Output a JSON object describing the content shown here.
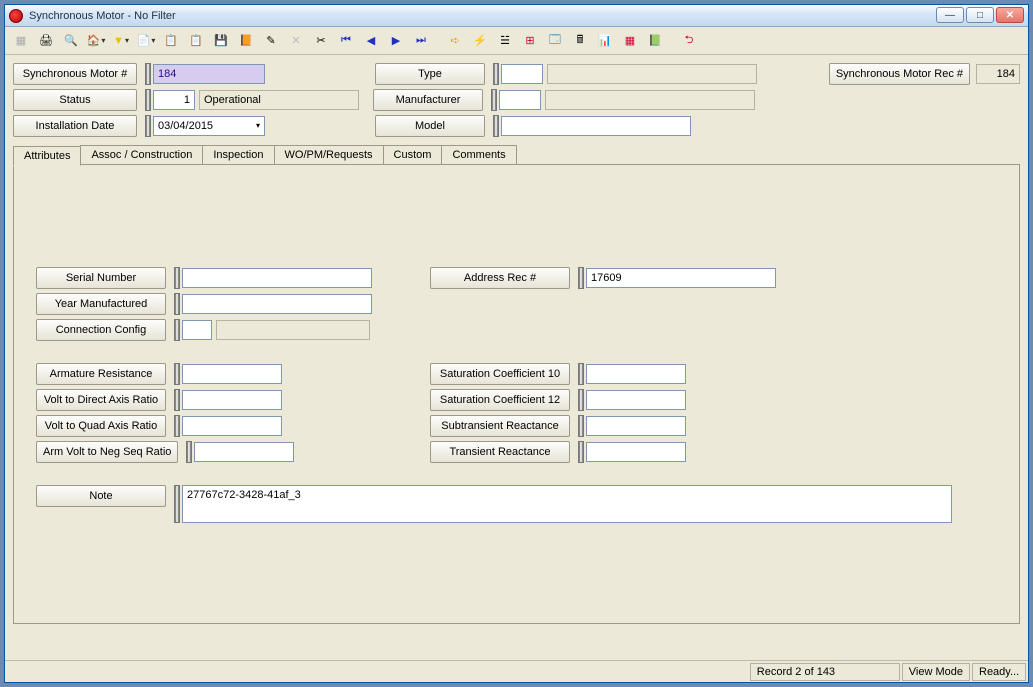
{
  "window": {
    "title": "Synchronous Motor - No Filter"
  },
  "header": {
    "sync_motor_num_label": "Synchronous Motor #",
    "sync_motor_num_value": "184",
    "status_label": "Status",
    "status_code": "1",
    "status_text": "Operational",
    "install_date_label": "Installation Date",
    "install_date_value": "03/04/2015",
    "type_label": "Type",
    "type_code": "",
    "type_text": "",
    "mfr_label": "Manufacturer",
    "mfr_code": "",
    "mfr_text": "",
    "model_label": "Model",
    "model_value": "",
    "rec_label": "Synchronous Motor Rec #",
    "rec_value": "184"
  },
  "tabs": {
    "t0": "Attributes",
    "t1": "Assoc / Construction",
    "t2": "Inspection",
    "t3": "WO/PM/Requests",
    "t4": "Custom",
    "t5": "Comments"
  },
  "attrs": {
    "serial_label": "Serial Number",
    "serial_value": "",
    "year_mfr_label": "Year Manufactured",
    "year_mfr_value": "",
    "conn_cfg_label": "Connection Config",
    "conn_cfg_code": "",
    "conn_cfg_text": "",
    "addr_rec_label": "Address Rec #",
    "addr_rec_value": "17609",
    "arm_res_label": "Armature Resistance",
    "arm_res_value": "",
    "vdar_label": "Volt to Direct Axis Ratio",
    "vdar_value": "",
    "vqar_label": "Volt to Quad Axis Ratio",
    "vqar_value": "",
    "avnsr_label": "Arm Volt to Neg Seq Ratio",
    "avnsr_value": "",
    "sat10_label": "Saturation Coefficient 10",
    "sat10_value": "",
    "sat12_label": "Saturation Coefficient 12",
    "sat12_value": "",
    "subtr_label": "Subtransient Reactance",
    "subtr_value": "",
    "trans_label": "Transient Reactance",
    "trans_value": "",
    "note_label": "Note",
    "note_value": "27767c72-3428-41af_3"
  },
  "status": {
    "record": "Record 2 of 143",
    "mode": "View Mode",
    "ready": "Ready..."
  }
}
